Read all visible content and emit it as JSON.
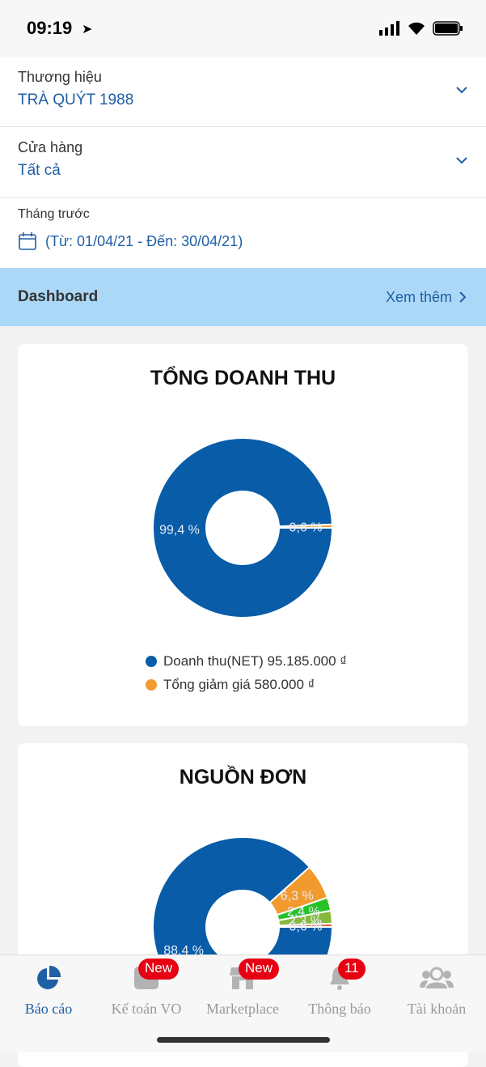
{
  "status": {
    "time": "09:19"
  },
  "filters": {
    "brand": {
      "label": "Thương hiệu",
      "value": "TRÀ QUÝT 1988"
    },
    "store": {
      "label": "Cửa hàng",
      "value": "Tất cả"
    },
    "period": {
      "label": "Tháng trước",
      "value": "(Từ: 01/04/21 - Đến: 30/04/21)"
    }
  },
  "dashboard": {
    "title": "Dashboard",
    "more": "Xem thêm"
  },
  "chart_data": [
    {
      "type": "pie",
      "title": "TỔNG DOANH THU",
      "series": [
        {
          "name": "Doanh thu(NET) 95.185.000 ₫",
          "value": 99.4,
          "label": "99,4 %",
          "color": "#085ca8"
        },
        {
          "name": "Tổng giảm giá 580.000 ₫",
          "value": 0.6,
          "label": "0,6 %",
          "color": "#f29a2e"
        }
      ],
      "legend": "bottom"
    },
    {
      "type": "pie",
      "title": "NGUỒN ĐƠN",
      "series": [
        {
          "value": 88.4,
          "label": "88,4 %",
          "color": "#085ca8"
        },
        {
          "value": 6.3,
          "label": "6,3 %",
          "color": "#f29a2e"
        },
        {
          "value": 2.4,
          "label": "2,4 %",
          "color": "#27c227"
        },
        {
          "value": 2.3,
          "label": "2,3 %",
          "color": "#86b83c"
        },
        {
          "value": 0.6,
          "label": "0,6 %",
          "color": "#e0603a"
        }
      ]
    }
  ],
  "tabs": [
    {
      "label": "Báo cáo",
      "icon": "pie-chart-icon",
      "active": true
    },
    {
      "label": "Kế toán VO",
      "icon": "calculator-icon",
      "badge": "New"
    },
    {
      "label": "Marketplace",
      "icon": "store-icon",
      "badge": "New"
    },
    {
      "label": "Thông báo",
      "icon": "bell-icon",
      "badge": "11"
    },
    {
      "label": "Tài khoản",
      "icon": "users-icon"
    }
  ],
  "colors": {
    "accent": "#1f5fa5",
    "banner": "#acd8f7",
    "badge": "#e60012"
  }
}
